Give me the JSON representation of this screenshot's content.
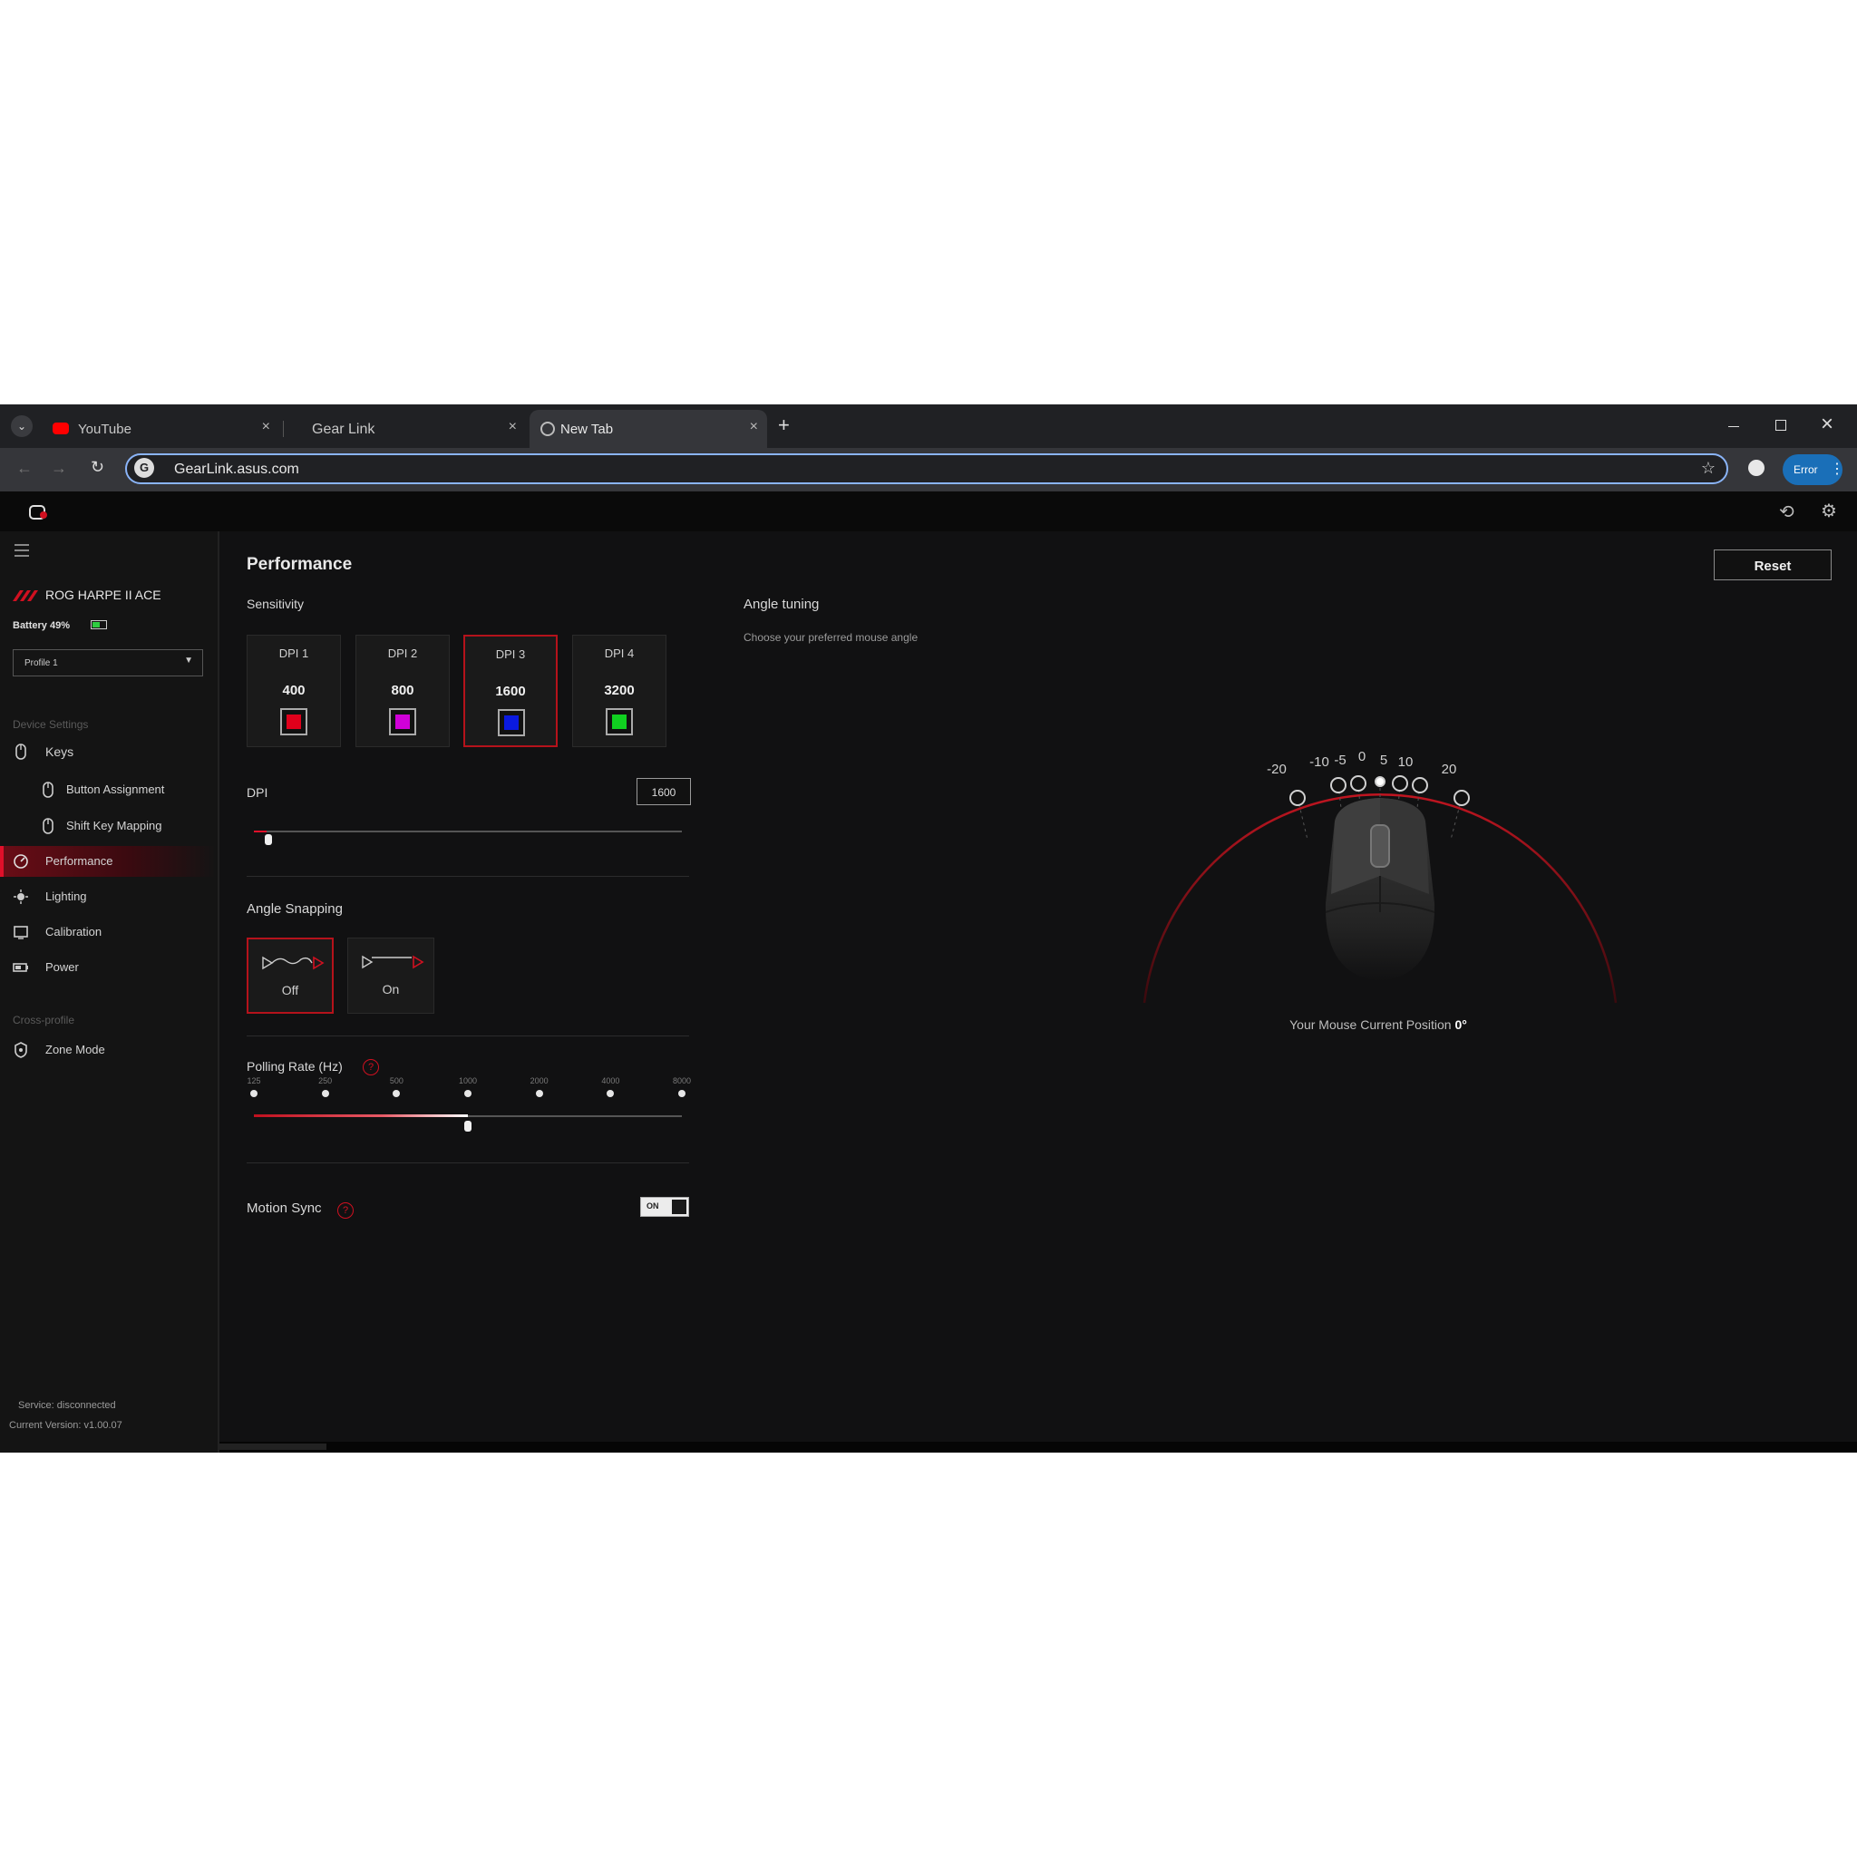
{
  "browser": {
    "tabs": [
      {
        "label": "YouTube",
        "active": false
      },
      {
        "label": "Gear Link",
        "active": false
      },
      {
        "label": "New Tab",
        "active": true
      }
    ],
    "new_tab_symbol": "+",
    "close_symbol": "×",
    "url": "GearLink.asus.com",
    "error_button": "Error"
  },
  "sidebar": {
    "device_name": "ROG HARPE II ACE",
    "battery": "Battery 49%",
    "profile": "Profile 1",
    "device_settings_heading": "Device Settings",
    "cross_profile_heading": "Cross-profile",
    "items": [
      {
        "label": "Keys",
        "icon": "mouse-icon"
      },
      {
        "label": "Button Assignment",
        "icon": "mouse-icon"
      },
      {
        "label": "Shift Key Mapping",
        "icon": "mouse-icon"
      },
      {
        "label": "Performance",
        "icon": "gauge-icon",
        "active": true
      },
      {
        "label": "Lighting",
        "icon": "light-icon"
      },
      {
        "label": "Calibration",
        "icon": "calibration-icon"
      },
      {
        "label": "Power",
        "icon": "battery-icon"
      },
      {
        "label": "Zone Mode",
        "icon": "zone-icon"
      }
    ],
    "service_status": "Service: disconnected",
    "version": "Current Version: v1.00.07"
  },
  "main": {
    "title": "Performance",
    "reset_label": "Reset",
    "sensitivity_label": "Sensitivity",
    "dpi_stages": [
      {
        "name": "DPI 1",
        "value": "400",
        "color": "#e0001b"
      },
      {
        "name": "DPI 2",
        "value": "800",
        "color": "#d000d8"
      },
      {
        "name": "DPI 3",
        "value": "1600",
        "color": "#0a1ae0",
        "selected": true
      },
      {
        "name": "DPI 4",
        "value": "3200",
        "color": "#10d020"
      }
    ],
    "dpi_label": "DPI",
    "dpi_value": "1600",
    "dpi_slider_fraction": 0.03,
    "angle_snapping_label": "Angle Snapping",
    "angle_snapping_options": [
      {
        "label": "Off",
        "selected": true
      },
      {
        "label": "On",
        "selected": false
      }
    ],
    "polling_rate_label": "Polling Rate (Hz)",
    "polling_rates": [
      "125",
      "250",
      "500",
      "1000",
      "2000",
      "4000",
      "8000"
    ],
    "polling_rate_selected": "1000",
    "motion_sync_label": "Motion Sync",
    "motion_sync_state": "ON",
    "help_symbol": "?"
  },
  "angle_tuning": {
    "title": "Angle tuning",
    "subtitle": "Choose your preferred mouse angle",
    "markers": [
      "-20",
      "-10",
      "-5",
      "0",
      "5",
      "10",
      "20"
    ],
    "selected": "0",
    "position_text": "Your Mouse Current Position",
    "position_value": "0°"
  }
}
